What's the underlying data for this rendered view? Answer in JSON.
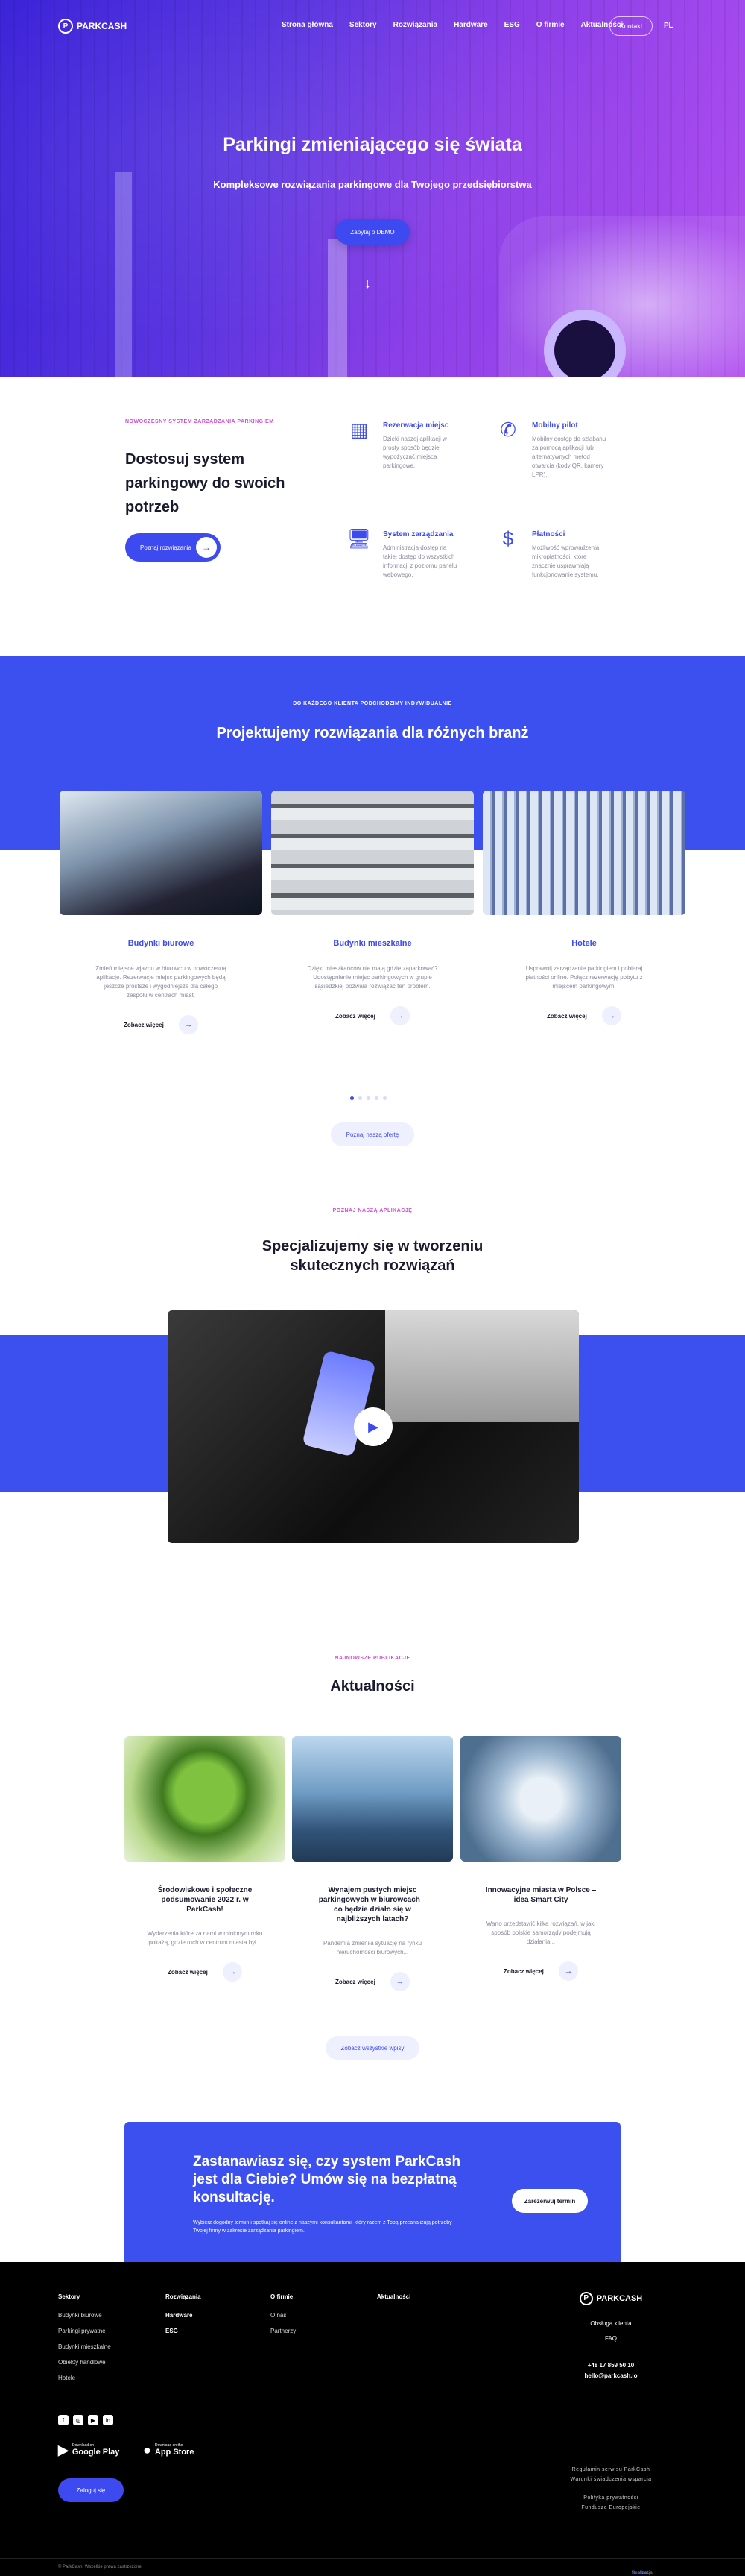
{
  "brand": {
    "name": "PARKCASH",
    "mark": "P"
  },
  "nav": {
    "items": [
      "Strona główna",
      "Sektory",
      "Rozwiązania",
      "Hardware",
      "ESG",
      "O firmie",
      "Aktualności"
    ],
    "button": "Kontakt",
    "lang": "PL"
  },
  "hero": {
    "title": "Parkingi zmieniającego się świata",
    "subtitle": "Kompleksowe rozwiązania parkingowe dla Twojego przedsiębiorstwa",
    "cta": "Zapytaj o DEMO",
    "arrow": "↓"
  },
  "features": {
    "eyebrow": "Nowoczesny system zarządzania parkingiem",
    "title": "Dostosuj system parkingowy do swoich potrzeb",
    "button": "Poznaj rozwiązania",
    "items": [
      {
        "icon": "parking-grid-icon",
        "glyph": "▦",
        "title": "Rezerwacja miejsc",
        "text": "Dzięki naszej aplikacji w prosty sposób będzie wypożyczać miejsca parkingowe."
      },
      {
        "icon": "phone-hand-icon",
        "glyph": "✆",
        "title": "Mobilny pilot",
        "text": "Mobilny dostęp do szlabanu za pomocą aplikacji lub alternatywnych metod otwarcia (kody QR, kamery LPR)."
      },
      {
        "icon": "monitor-icon",
        "glyph": "🖥",
        "title": "System zarządzania",
        "text": "Administracja dostęp na takiej dostęp do wszystkich informacji z poziomu panelu webowego."
      },
      {
        "icon": "payment-icon",
        "glyph": "$",
        "title": "Płatności",
        "text": "Możliwość wprowadzenia mikropłatności, które znacznie usprawniają funkcjonowanie systemu."
      }
    ]
  },
  "sectors": {
    "eyebrow": "Do każdego klienta podchodzimy indywidualnie",
    "title": "Projektujemy rozwiązania dla różnych branż",
    "more": "Zobacz więcej",
    "all": "Poznaj naszą ofertę",
    "cards": [
      {
        "title": "Budynki biurowe",
        "text": "Zmień miejsce wjazdu w biurowcu w nowoczesną aplikację. Rezerwacje miejsc parkingowych będą jeszcze prostsze i wygodniejsze dla całego zespołu w centrach miast."
      },
      {
        "title": "Budynki mieszkalne",
        "text": "Dzięki mieszkańców nie mają gdzie zaparkować? Udostępnienie miejsc parkingowych w grupie sąsiedzkiej pozwala rozwiązać ten problem."
      },
      {
        "title": "Hotele",
        "text": "Usprawnij zarządzanie parkingiem i pobieraj płatności online. Połącz rezerwację pobytu z miejscem parkingowym."
      }
    ]
  },
  "app": {
    "eyebrow": "Poznaj naszą aplikację",
    "title": "Specjalizujemy się w tworzeniu skutecznych rozwiązań",
    "play": "▶"
  },
  "news": {
    "eyebrow": "Najnowsze publikacje",
    "title": "Aktualności",
    "more": "Zobacz więcej",
    "all": "Zobacz wszystkie wpisy",
    "items": [
      {
        "title": "Środowiskowe i społeczne podsumowanie 2022 r. w ParkCash!",
        "text": "Wydarzenia które za nami w minionym roku pokażą, gdzie ruch w centrum miasta był..."
      },
      {
        "title": "Wynajem pustych miejsc parkingowych w biurowcach – co będzie działo się w najbliższych latach?",
        "text": "Pandemia zmieniła sytuację na rynku nieruchomości biurowych..."
      },
      {
        "title": "Innowacyjne miasta w Polsce – idea Smart City",
        "text": "Warto przedstawić kilka rozwiązań, w jaki sposób polskie samorządy podejmują działania..."
      }
    ]
  },
  "cta": {
    "title": "Zastanawiasz się, czy system ParkCash jest dla Ciebie? Umów się na bezpłatną konsultację.",
    "text": "Wybierz dogodny termin i spotkaj się online z naszymi konsultantami, który razem z Tobą przeanalizują potrzeby Twojej firmy w zakresie zarządzania parkingiem.",
    "button": "Zarezerwuj termin"
  },
  "footer": {
    "cols": [
      {
        "title": "Sektory",
        "items": [
          "Budynki biurowe",
          "Parkingi prywatne",
          "Budynki mieszkalne",
          "Obiekty handlowe",
          "Hotele"
        ]
      },
      {
        "title": "Rozwiązania",
        "items": [
          "Hardware",
          "ESG"
        ]
      },
      {
        "title": "O firmie",
        "items": [
          "O nas",
          "Partnerzy"
        ]
      },
      {
        "title": "Aktualności",
        "items": []
      }
    ],
    "contact": {
      "label": "Obsługa klienta",
      "hours": "FAQ",
      "phone": "+48 17 859 50 10",
      "email": "hello@parkcash.io"
    },
    "social": [
      "f",
      "◎",
      "▶",
      "in"
    ],
    "stores": [
      {
        "small": "Download on",
        "name": "Google Play",
        "icon": "▶"
      },
      {
        "small": "Download on the",
        "name": "App Store",
        "icon": ""
      }
    ],
    "login": "Zaloguj się",
    "legal": [
      "Regulamin serwisu ParkCash",
      "Warunki świadczenia wsparcia",
      "Polityka prywatności",
      "Fundusze Europejskie"
    ],
    "copyright": "© ParkCash. Wszelkie prawa zastrzeżone.",
    "credit": "Realizacja: ",
    "credit_link": "webfleet"
  }
}
